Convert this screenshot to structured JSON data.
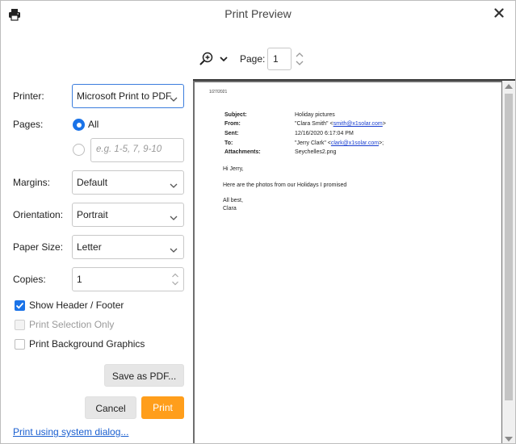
{
  "window": {
    "title": "Print Preview"
  },
  "toolbar": {
    "page_label": "Page:",
    "page_value": "1"
  },
  "form": {
    "printer_label": "Printer:",
    "printer_value": "Microsoft Print to PDF",
    "pages_label": "Pages:",
    "pages_all_label": "All",
    "pages_custom_placeholder": "e.g. 1-5, 7, 9-10",
    "margins_label": "Margins:",
    "margins_value": "Default",
    "orientation_label": "Orientation:",
    "orientation_value": "Portrait",
    "paper_size_label": "Paper Size:",
    "paper_size_value": "Letter",
    "copies_label": "Copies:",
    "copies_value": "1",
    "show_header_footer_label": "Show Header / Footer",
    "print_selection_label": "Print Selection Only",
    "print_background_label": "Print Background Graphics",
    "save_pdf_label": "Save as PDF...",
    "cancel_label": "Cancel",
    "print_label": "Print",
    "system_dialog_link": "Print using system dialog..."
  },
  "preview": {
    "date": "1/27/2021",
    "subject_key": "Subject:",
    "subject_val": "Holiday pictures",
    "from_key": "From:",
    "from_name": "\"Clara Smith\" <",
    "from_email": "smith@x1solar.com",
    "from_close": ">",
    "sent_key": "Sent:",
    "sent_val": "12/16/2020 6:17:04 PM",
    "to_key": "To:",
    "to_name": "\"Jerry Clark\" <",
    "to_email": "clark@x1solar.com",
    "to_close": ">;",
    "attach_key": "Attachments:",
    "attach_val": "Seychelles2.png",
    "greeting": "Hi Jerry,",
    "body": "Here are the photos from our Holidays I promised",
    "closing": "All best,",
    "signature": "Clara"
  },
  "colors": {
    "accent": "#1a73e8",
    "print_button": "#ff9e1b",
    "link": "#1a5fd0"
  }
}
